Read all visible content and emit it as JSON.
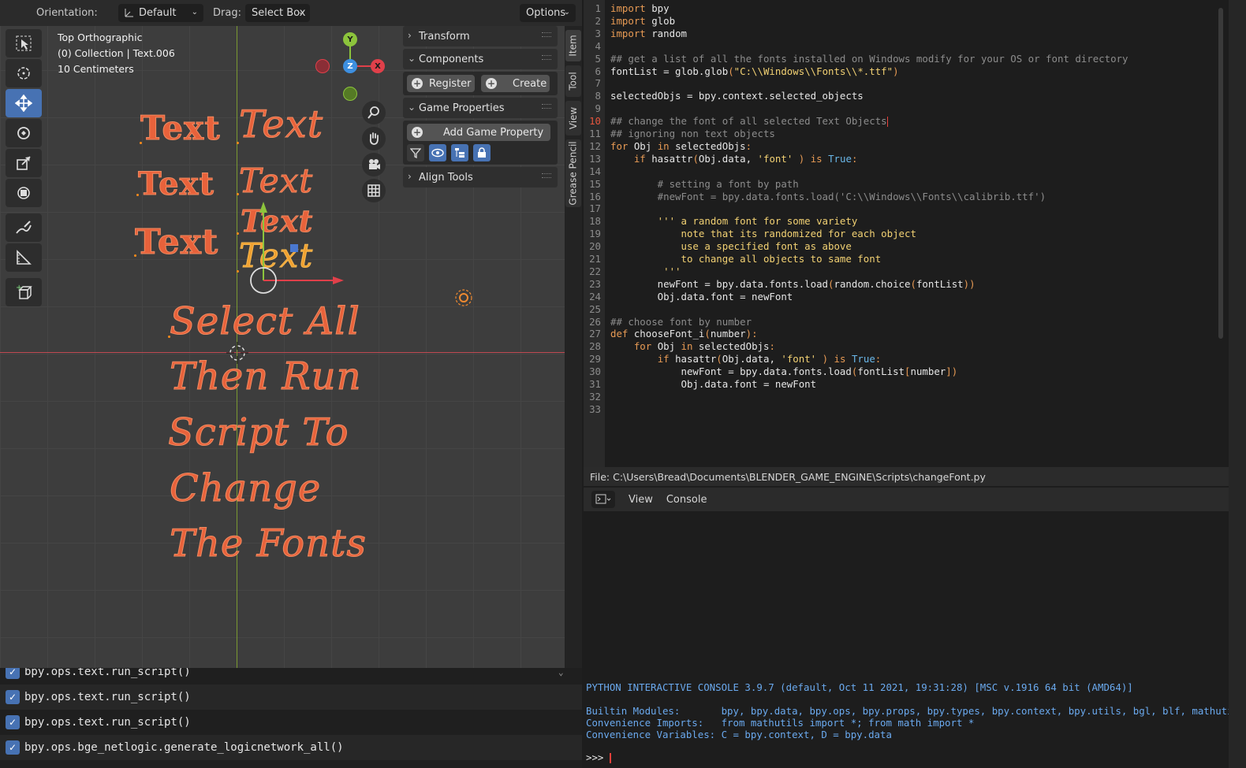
{
  "header": {
    "orientation_label": "Orientation:",
    "orientation_value": "Default",
    "drag_label": "Drag:",
    "drag_value": "Select Box",
    "options_label": "Options"
  },
  "viewport": {
    "view_name": "Top Orthographic",
    "collection": "(0) Collection | Text.006",
    "scale": "10 Centimeters",
    "gizmo": {
      "x": "X",
      "y": "Y",
      "z": "Z"
    },
    "texts": {
      "t1": "Text",
      "t2": "Text",
      "t3": "Text",
      "t4": "Text",
      "t5": "Text",
      "t6": "Text",
      "t7": "Text",
      "t8": "Text",
      "msg1": "Select All",
      "msg2": "Then Run",
      "msg3": "Script To",
      "msg4": "Change",
      "msg5": "The Fonts"
    }
  },
  "npanel": {
    "transform": "Transform",
    "components": "Components",
    "register": "Register",
    "create": "Create",
    "game_properties": "Game Properties",
    "add_game_property": "Add Game Property",
    "align_tools": "Align Tools",
    "tabs": [
      "Item",
      "Tool",
      "View",
      "Grease Pencil"
    ]
  },
  "info_log": [
    "bpy.ops.text.run_script()",
    "bpy.ops.text.run_script()",
    "bpy.ops.text.run_script()",
    "bpy.ops.bge_netlogic.generate_logicnetwork_all()"
  ],
  "editor": {
    "current_line": 10,
    "lines": [
      "import bpy",
      "import glob",
      "import random",
      "",
      "## get a list of all the fonts installed on Windows modify for your OS or font directory",
      "fontList = glob.glob(\"C:\\\\Windows\\\\Fonts\\\\*.ttf\")",
      "",
      "selectedObjs = bpy.context.selected_objects",
      "",
      "## change the font of all selected Text Objects",
      "## ignoring non text objects",
      "for Obj in selectedObjs:",
      "    if hasattr(Obj.data, 'font' ) is True:",
      "",
      "        # setting a font by path",
      "        #newFont = bpy.data.fonts.load('C:\\\\Windows\\\\Fonts\\\\calibrib.ttf')",
      "",
      "        ''' a random font for some variety",
      "            note that its randomized for each object",
      "            use a specified font as above",
      "            to change all objects to same font",
      "         '''",
      "        newFont = bpy.data.fonts.load(random.choice(fontList))",
      "        Obj.data.font = newFont",
      "",
      "## choose font by number",
      "def chooseFont_i(number):",
      "    for Obj in selectedObjs:",
      "        if hasattr(Obj.data, 'font' ) is True:",
      "            newFont = bpy.data.fonts.load(fontList[number])",
      "            Obj.data.font = newFont",
      "",
      ""
    ],
    "file_path": "File: C:\\Users\\Bread\\Documents\\BLENDER_GAME_ENGINE\\Scripts\\changeFont.py"
  },
  "console": {
    "menu_view": "View",
    "menu_console": "Console",
    "banner": "PYTHON INTERACTIVE CONSOLE 3.9.7 (default, Oct 11 2021, 19:31:28) [MSC v.1916 64 bit (AMD64)]",
    "builtin": "Builtin Modules:       bpy, bpy.data, bpy.ops, bpy.props, bpy.types, bpy.context, bpy.utils, bgl, blf, mathutils",
    "imports": "Convenience Imports:   from mathutils import *; from math import *",
    "variables": "Convenience Variables: C = bpy.context, D = bpy.data",
    "prompt": ">>> "
  },
  "colors": {
    "accent": "#4772b3",
    "text_object": "#e8623b",
    "selected_text": "#f0a030",
    "keyword": "#e79a54",
    "string": "#f2d173",
    "console_output": "#6aa9ee"
  }
}
